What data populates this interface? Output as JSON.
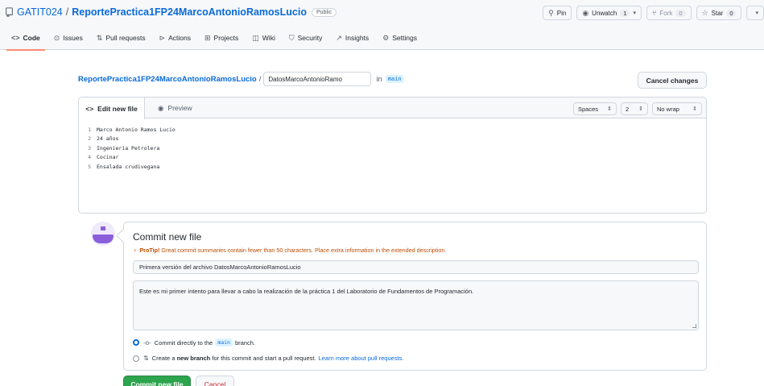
{
  "repo": {
    "owner": "GATIT024",
    "separator": "/",
    "name": "ReportePractica1FP24MarcoAntonioRamosLucio",
    "visibility": "Public"
  },
  "actions": {
    "pin": "Pin",
    "unwatch": "Unwatch",
    "unwatch_count": "1",
    "fork": "Fork",
    "fork_count": "0",
    "star": "Star",
    "star_count": "0"
  },
  "nav": {
    "code": "Code",
    "issues": "Issues",
    "pull_requests": "Pull requests",
    "actions": "Actions",
    "projects": "Projects",
    "wiki": "Wiki",
    "security": "Security",
    "insights": "Insights",
    "settings": "Settings"
  },
  "breadcrumb": {
    "repo": "ReportePractica1FP24MarcoAntonioRamosLucio",
    "slash": "/",
    "filename": "DatosMarcoAntonioRamo",
    "in": "in",
    "branch": "main"
  },
  "cancel_changes": "Cancel changes",
  "editor": {
    "tab_edit": "Edit new file",
    "tab_preview": "Preview",
    "indent_mode": "Spaces",
    "indent_size": "2",
    "wrap_mode": "No wrap",
    "lines": [
      {
        "n": "1",
        "text": "Marco Antonio Ramos Lucio"
      },
      {
        "n": "2",
        "text": "24 años"
      },
      {
        "n": "3",
        "text": "Ingeniería Petrolera"
      },
      {
        "n": "4",
        "text": "Cocinar"
      },
      {
        "n": "5",
        "text": "Ensalada crudivegana"
      }
    ]
  },
  "commit": {
    "title": "Commit new file",
    "protip_label": "ProTip!",
    "protip_text": "Great commit summaries contain fewer than 50 characters. Place extra information in the extended description.",
    "summary": "Primera versión del archivo DatosMarcoAntonioRamosLucio",
    "description": "Este es mi primer intento para llevar a cabo la realización de la práctica 1 del Laboratorio de Fundamentos de Programación.",
    "option_direct_prefix": "Commit directly to the",
    "option_direct_branch": "main",
    "option_direct_suffix": "branch.",
    "option_new_prefix": "Create a",
    "option_new_bold": "new branch",
    "option_new_suffix": "for this commit and start a pull request.",
    "option_new_link": "Learn more about pull requests.",
    "commit_button": "Commit new file",
    "cancel_button": "Cancel"
  }
}
